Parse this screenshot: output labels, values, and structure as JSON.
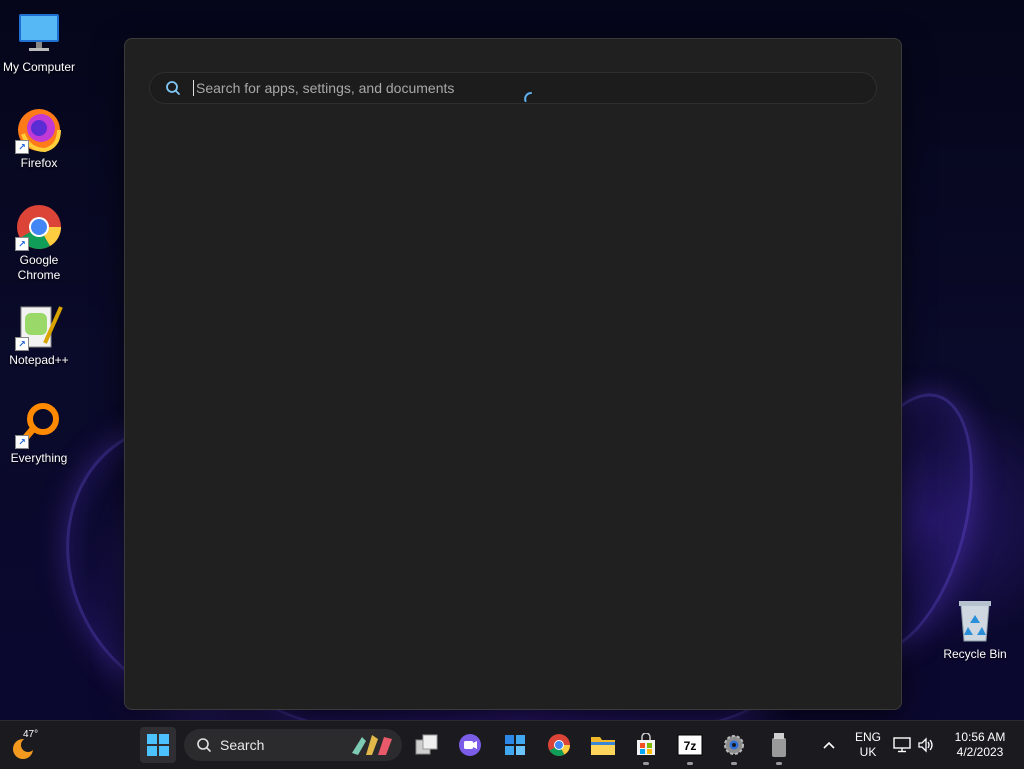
{
  "desktop": {
    "icons": [
      {
        "label": "My Computer",
        "icon": "monitor-icon"
      },
      {
        "label": "Firefox",
        "icon": "firefox-icon"
      },
      {
        "label": "Google Chrome",
        "icon": "chrome-icon"
      },
      {
        "label": "Notepad++",
        "icon": "notepadpp-icon"
      },
      {
        "label": "Everything",
        "icon": "everything-search-icon"
      },
      {
        "label": "Recycle Bin",
        "icon": "recycle-bin-icon"
      }
    ]
  },
  "start_search": {
    "placeholder": "Search for apps, settings, and documents",
    "value": ""
  },
  "taskbar": {
    "weather": {
      "temp": "47°"
    },
    "search_label": "Search",
    "apps": [
      "start-icon",
      "task-view-icon",
      "chat-icon",
      "widgets-icon",
      "chrome-icon",
      "file-explorer-icon",
      "store-icon",
      "7zip-icon",
      "settings-icon",
      "usb-drive-icon"
    ],
    "tray": {
      "lang_top": "ENG",
      "lang_bottom": "UK",
      "time": "10:56 AM",
      "date": "4/2/2023"
    }
  },
  "colors": {
    "accent": "#0f6cbd",
    "panel_bg": "#202020",
    "taskbar_bg": "#1b1b1f"
  }
}
